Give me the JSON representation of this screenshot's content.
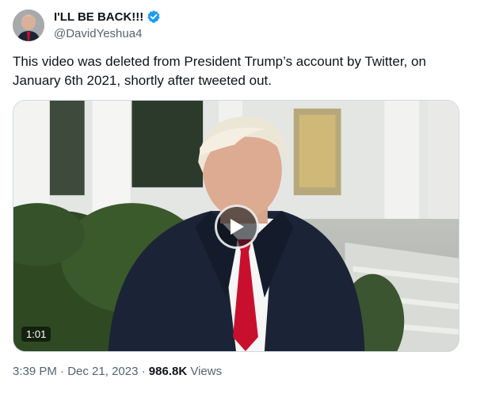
{
  "author": {
    "display_name": "I'LL BE BACK!!!",
    "handle": "@DavidYeshua4",
    "verified_badge_color": "#1d9bf0",
    "avatar_icon": "profile-avatar"
  },
  "tweet": {
    "text": "This video was deleted from President Trump’s account by Twitter, on January 6th 2021, shortly after tweeted out."
  },
  "media": {
    "type": "video",
    "duration": "1:01",
    "play_icon": "play-icon"
  },
  "meta": {
    "time": "3:39 PM",
    "separator": "·",
    "date": "Dec 21, 2023",
    "views_count": "986.8K",
    "views_label": "Views"
  }
}
